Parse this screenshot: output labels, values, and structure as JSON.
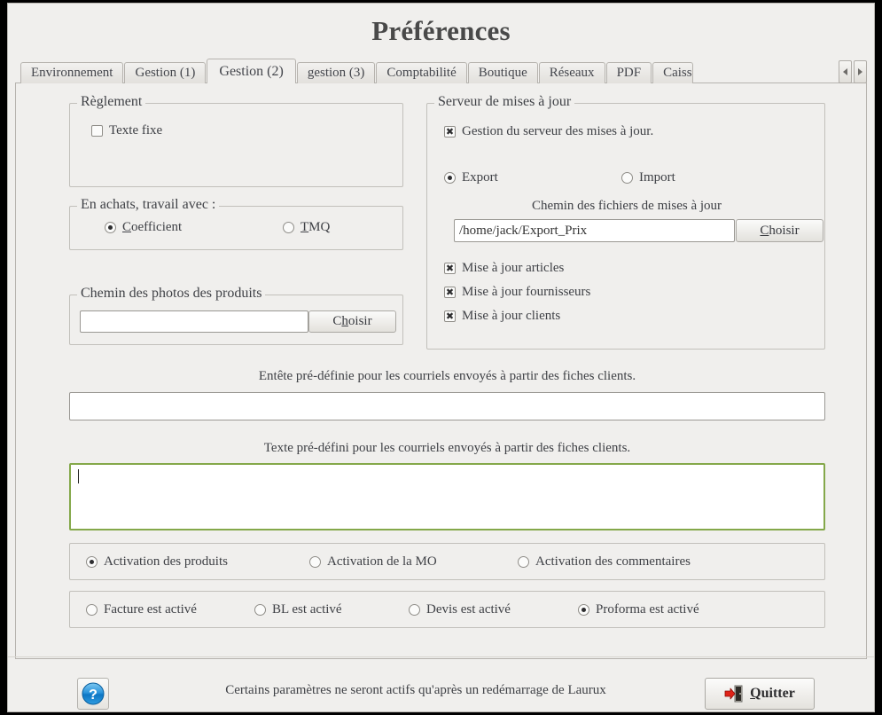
{
  "window": {
    "title": "Préférences"
  },
  "tabs": [
    {
      "label": "Environnement",
      "active": false
    },
    {
      "label": "Gestion (1)",
      "active": false
    },
    {
      "label": "Gestion (2)",
      "active": true
    },
    {
      "label": "gestion (3)",
      "active": false
    },
    {
      "label": "Comptabilité",
      "active": false
    },
    {
      "label": "Boutique",
      "active": false
    },
    {
      "label": "Réseaux",
      "active": false
    },
    {
      "label": "PDF",
      "active": false
    },
    {
      "label": "Caisse",
      "active": false
    }
  ],
  "tab_scroll": {
    "left_icon": "chevron-left-icon",
    "right_icon": "chevron-right-icon"
  },
  "reglement": {
    "legend": "Règlement",
    "texte_fixe_label": "Texte fixe",
    "texte_fixe_checked": false
  },
  "achats": {
    "legend": "En achats, travail avec :",
    "options": [
      {
        "label": "Coefficient",
        "mnemonic": "C",
        "rest": "oefficient",
        "checked": true
      },
      {
        "label": "TMQ",
        "mnemonic": "T",
        "rest": "MQ",
        "checked": false
      }
    ]
  },
  "photos": {
    "legend": "Chemin des photos des produits",
    "path_value": "",
    "path_placeholder": "",
    "choose_mnemonic": "h",
    "choose_pre": "C",
    "choose_post": "oisir",
    "choose_label": "Choisir"
  },
  "serveur": {
    "legend": "Serveur de mises à jour",
    "gestion_label": "Gestion du serveur des mises à jour.",
    "gestion_checked": true,
    "mode_options": [
      {
        "label": "Export",
        "checked": true
      },
      {
        "label": "Import",
        "checked": false
      }
    ],
    "path_caption": "Chemin des fichiers de mises à jour",
    "path_value": "/home/jack/Export_Prix",
    "choose_mnemonic": "C",
    "choose_post": "hoisir",
    "choose_label": "Choisir",
    "updates": [
      {
        "label": "Mise à jour articles",
        "checked": true
      },
      {
        "label": "Mise à jour fournisseurs",
        "checked": true
      },
      {
        "label": "Mise à jour clients",
        "checked": true
      }
    ]
  },
  "mail": {
    "header_caption": "Entête pré-définie pour les courriels envoyés à partir des fiches clients.",
    "header_value": "",
    "body_caption": "Texte pré-défini pour les courriels envoyés à partir des fiches clients.",
    "body_value": "",
    "body_focus_color": "#84a84a"
  },
  "activation_row": [
    {
      "label": "Activation des produits",
      "checked": true
    },
    {
      "label": "Activation de la MO",
      "checked": false
    },
    {
      "label": "Activation des commentaires",
      "checked": false
    }
  ],
  "document_row": [
    {
      "label": "Facture est activé",
      "checked": false
    },
    {
      "label": "BL est activé",
      "checked": false
    },
    {
      "label": "Devis est activé",
      "checked": false
    },
    {
      "label": "Proforma est activé",
      "checked": true
    }
  ],
  "footer": {
    "help_icon": "help-question-icon",
    "note": "Certains paramètres ne seront actifs qu'après un redémarrage de Laurux",
    "quit_icon": "exit-door-icon",
    "quit_mnemonic": "Q",
    "quit_post": "uitter",
    "quit_label": "Quitter"
  }
}
